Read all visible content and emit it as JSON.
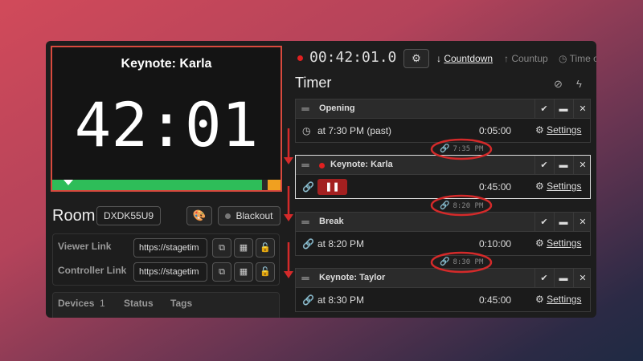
{
  "preview": {
    "title": "Keynote: Karla",
    "clock": "42:01",
    "progress": 0.92
  },
  "room": {
    "label": "Room",
    "code": "DXDK55U9",
    "palette_icon": "palette-icon",
    "blackout_label": "Blackout"
  },
  "links": [
    {
      "label": "Viewer Link",
      "value": "https://stagetim"
    },
    {
      "label": "Controller Link",
      "value": "https://stagetim"
    }
  ],
  "devices": {
    "label": "Devices",
    "count": "1",
    "status": "Status",
    "tags": "Tags"
  },
  "top": {
    "time": "00:42:01.0",
    "countdown": "Countdown",
    "countup": "Countup",
    "timeofday": "Time o"
  },
  "timer_header": "Timer",
  "cues": [
    {
      "name": "Opening",
      "start": "at 7:30 PM (past)",
      "duration": "0:05:00",
      "settings": "Settings"
    },
    {
      "name": "Keynote: Karla",
      "start": "",
      "duration": "0:45:00",
      "settings": "Settings"
    },
    {
      "name": "Break",
      "start": "at 8:20 PM",
      "duration": "0:10:00",
      "settings": "Settings"
    },
    {
      "name": "Keynote: Taylor",
      "start": "at 8:30 PM",
      "duration": "0:45:00",
      "settings": "Settings"
    }
  ],
  "link_times": [
    "7:35 PM",
    "8:20 PM",
    "8:30 PM"
  ],
  "colors": {
    "accent_red": "#d84a3e",
    "progress_green": "#2ebd59",
    "progress_orange": "#f0a020"
  }
}
